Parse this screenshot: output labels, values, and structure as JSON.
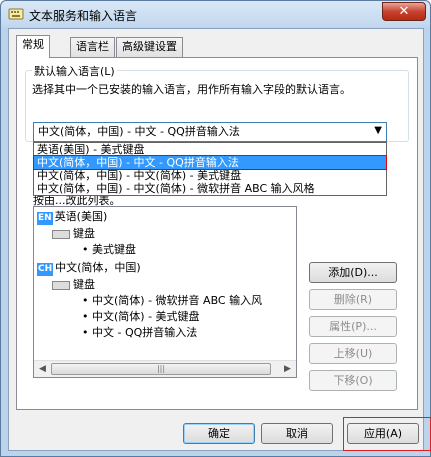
{
  "window": {
    "title": "文本服务和输入语言",
    "close_label": "✕"
  },
  "tabs": [
    {
      "label": "常规"
    },
    {
      "label": "语言栏"
    },
    {
      "label": "高级键设置"
    }
  ],
  "default_lang": {
    "label": "默认输入语言(L)",
    "description": "选择其中一个已安装的输入语言，用作所有输入字段的默认语言。",
    "combo_value": "中文(简体，中国) - 中文 - QQ拼音输入法",
    "options": [
      "英语(美国) - 美式键盘",
      "中文(简体，中国) - 中文 - QQ拼音输入法",
      "中文(简体，中国) - 中文(简体) - 美式键盘",
      "中文(简体，中国) - 中文(简体) - 微软拼音 ABC 输入风格"
    ]
  },
  "installed": {
    "partial_label": "按由...改此列表。",
    "tree": {
      "lang1_icon": "EN",
      "lang1": "英语(美国)",
      "lang1_group": "键盘",
      "lang1_kbd": "美式键盘",
      "lang2_icon": "CH",
      "lang2": "中文(简体，中国)",
      "lang2_group": "键盘",
      "lang2_items": [
        "中文(简体) - 微软拼音 ABC 输入风",
        "中文(简体) - 美式键盘",
        "中文 - QQ拼音输入法"
      ]
    }
  },
  "side_buttons": {
    "add": "添加(D)...",
    "remove": "删除(R)",
    "properties": "属性(P)...",
    "move_up": "上移(U)",
    "move_down": "下移(O)"
  },
  "bottom_buttons": {
    "ok": "确定",
    "cancel": "取消",
    "apply": "应用(A)"
  }
}
